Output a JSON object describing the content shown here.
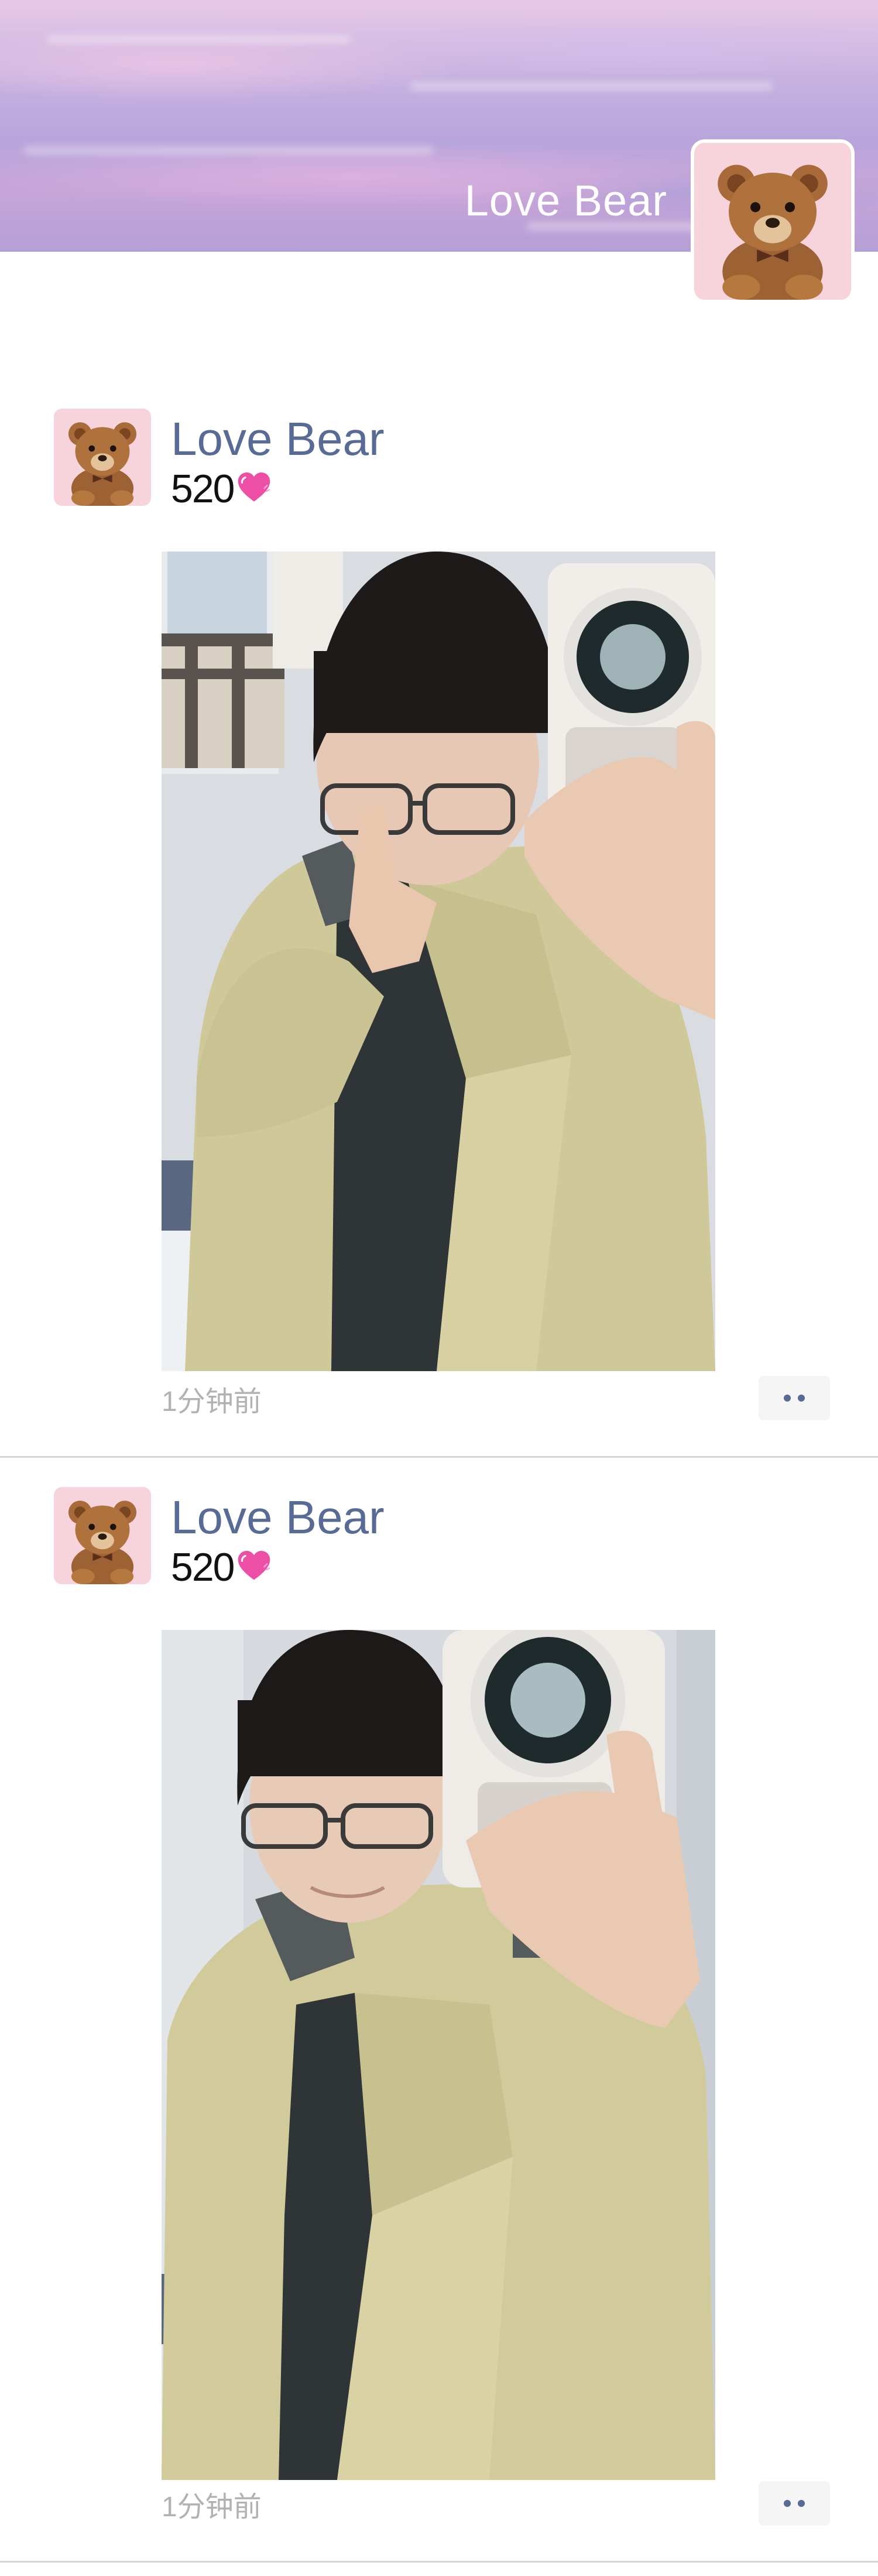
{
  "profile": {
    "name": "Love Bear",
    "avatar_icon": "teddy-bear-avatar"
  },
  "feed": {
    "posts": [
      {
        "author": "Love Bear",
        "text": "520",
        "emoji": "pink-heart-icon",
        "image_description": "selfie-photo",
        "time": "1分钟前",
        "more_icon": "more-dots-icon"
      },
      {
        "author": "Love Bear",
        "text": "520",
        "emoji": "pink-heart-icon",
        "image_description": "selfie-photo",
        "time": "1分钟前",
        "more_icon": "more-dots-icon"
      }
    ]
  },
  "colors": {
    "name_blue": "#576b95",
    "timestamp_gray": "#b2b2b2",
    "avatar_pink": "#f7d3dc",
    "jacket": "#cfc99a"
  }
}
